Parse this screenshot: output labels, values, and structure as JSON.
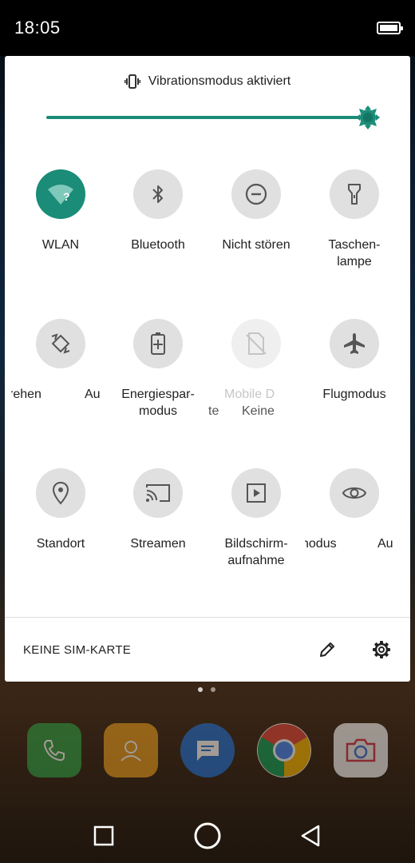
{
  "status_bar": {
    "time": "18:05"
  },
  "panel": {
    "vibration_text": "Vibrationsmodus aktiviert",
    "brightness_level": 1.0,
    "accent_color": "#1a8c78",
    "tiles": [
      {
        "label": "WLAN",
        "icon": "wifi-question-icon",
        "state": "active"
      },
      {
        "label": "Bluetooth",
        "icon": "bluetooth-icon",
        "state": "inactive"
      },
      {
        "label": "Nicht stören",
        "icon": "do-not-disturb-icon",
        "state": "inactive"
      },
      {
        "label": "Taschen-",
        "label2": "lampe",
        "icon": "flashlight-icon",
        "state": "inactive"
      },
      {
        "label_a": "rehen",
        "label_b": "Au",
        "icon": "auto-rotate-icon",
        "state": "inactive"
      },
      {
        "label": "Energiespar-",
        "label2": "modus",
        "icon": "battery-saver-icon",
        "state": "inactive"
      },
      {
        "label_a": "Mobile D",
        "label_b": "te",
        "label_c": "Keine",
        "icon": "mobile-data-off-icon",
        "state": "disabled"
      },
      {
        "label": "Flugmodus",
        "icon": "airplane-icon",
        "state": "inactive"
      },
      {
        "label": "Standort",
        "icon": "location-icon",
        "state": "inactive"
      },
      {
        "label": "Streamen",
        "icon": "cast-icon",
        "state": "inactive"
      },
      {
        "label": "Bildschirm-",
        "label2": "aufnahme",
        "icon": "screen-record-icon",
        "state": "inactive"
      },
      {
        "label_a": "nodus",
        "label_b": "Au",
        "icon": "eye-icon",
        "state": "inactive"
      }
    ],
    "footer": {
      "sim_text": "KEINE SIM-KARTE"
    }
  }
}
